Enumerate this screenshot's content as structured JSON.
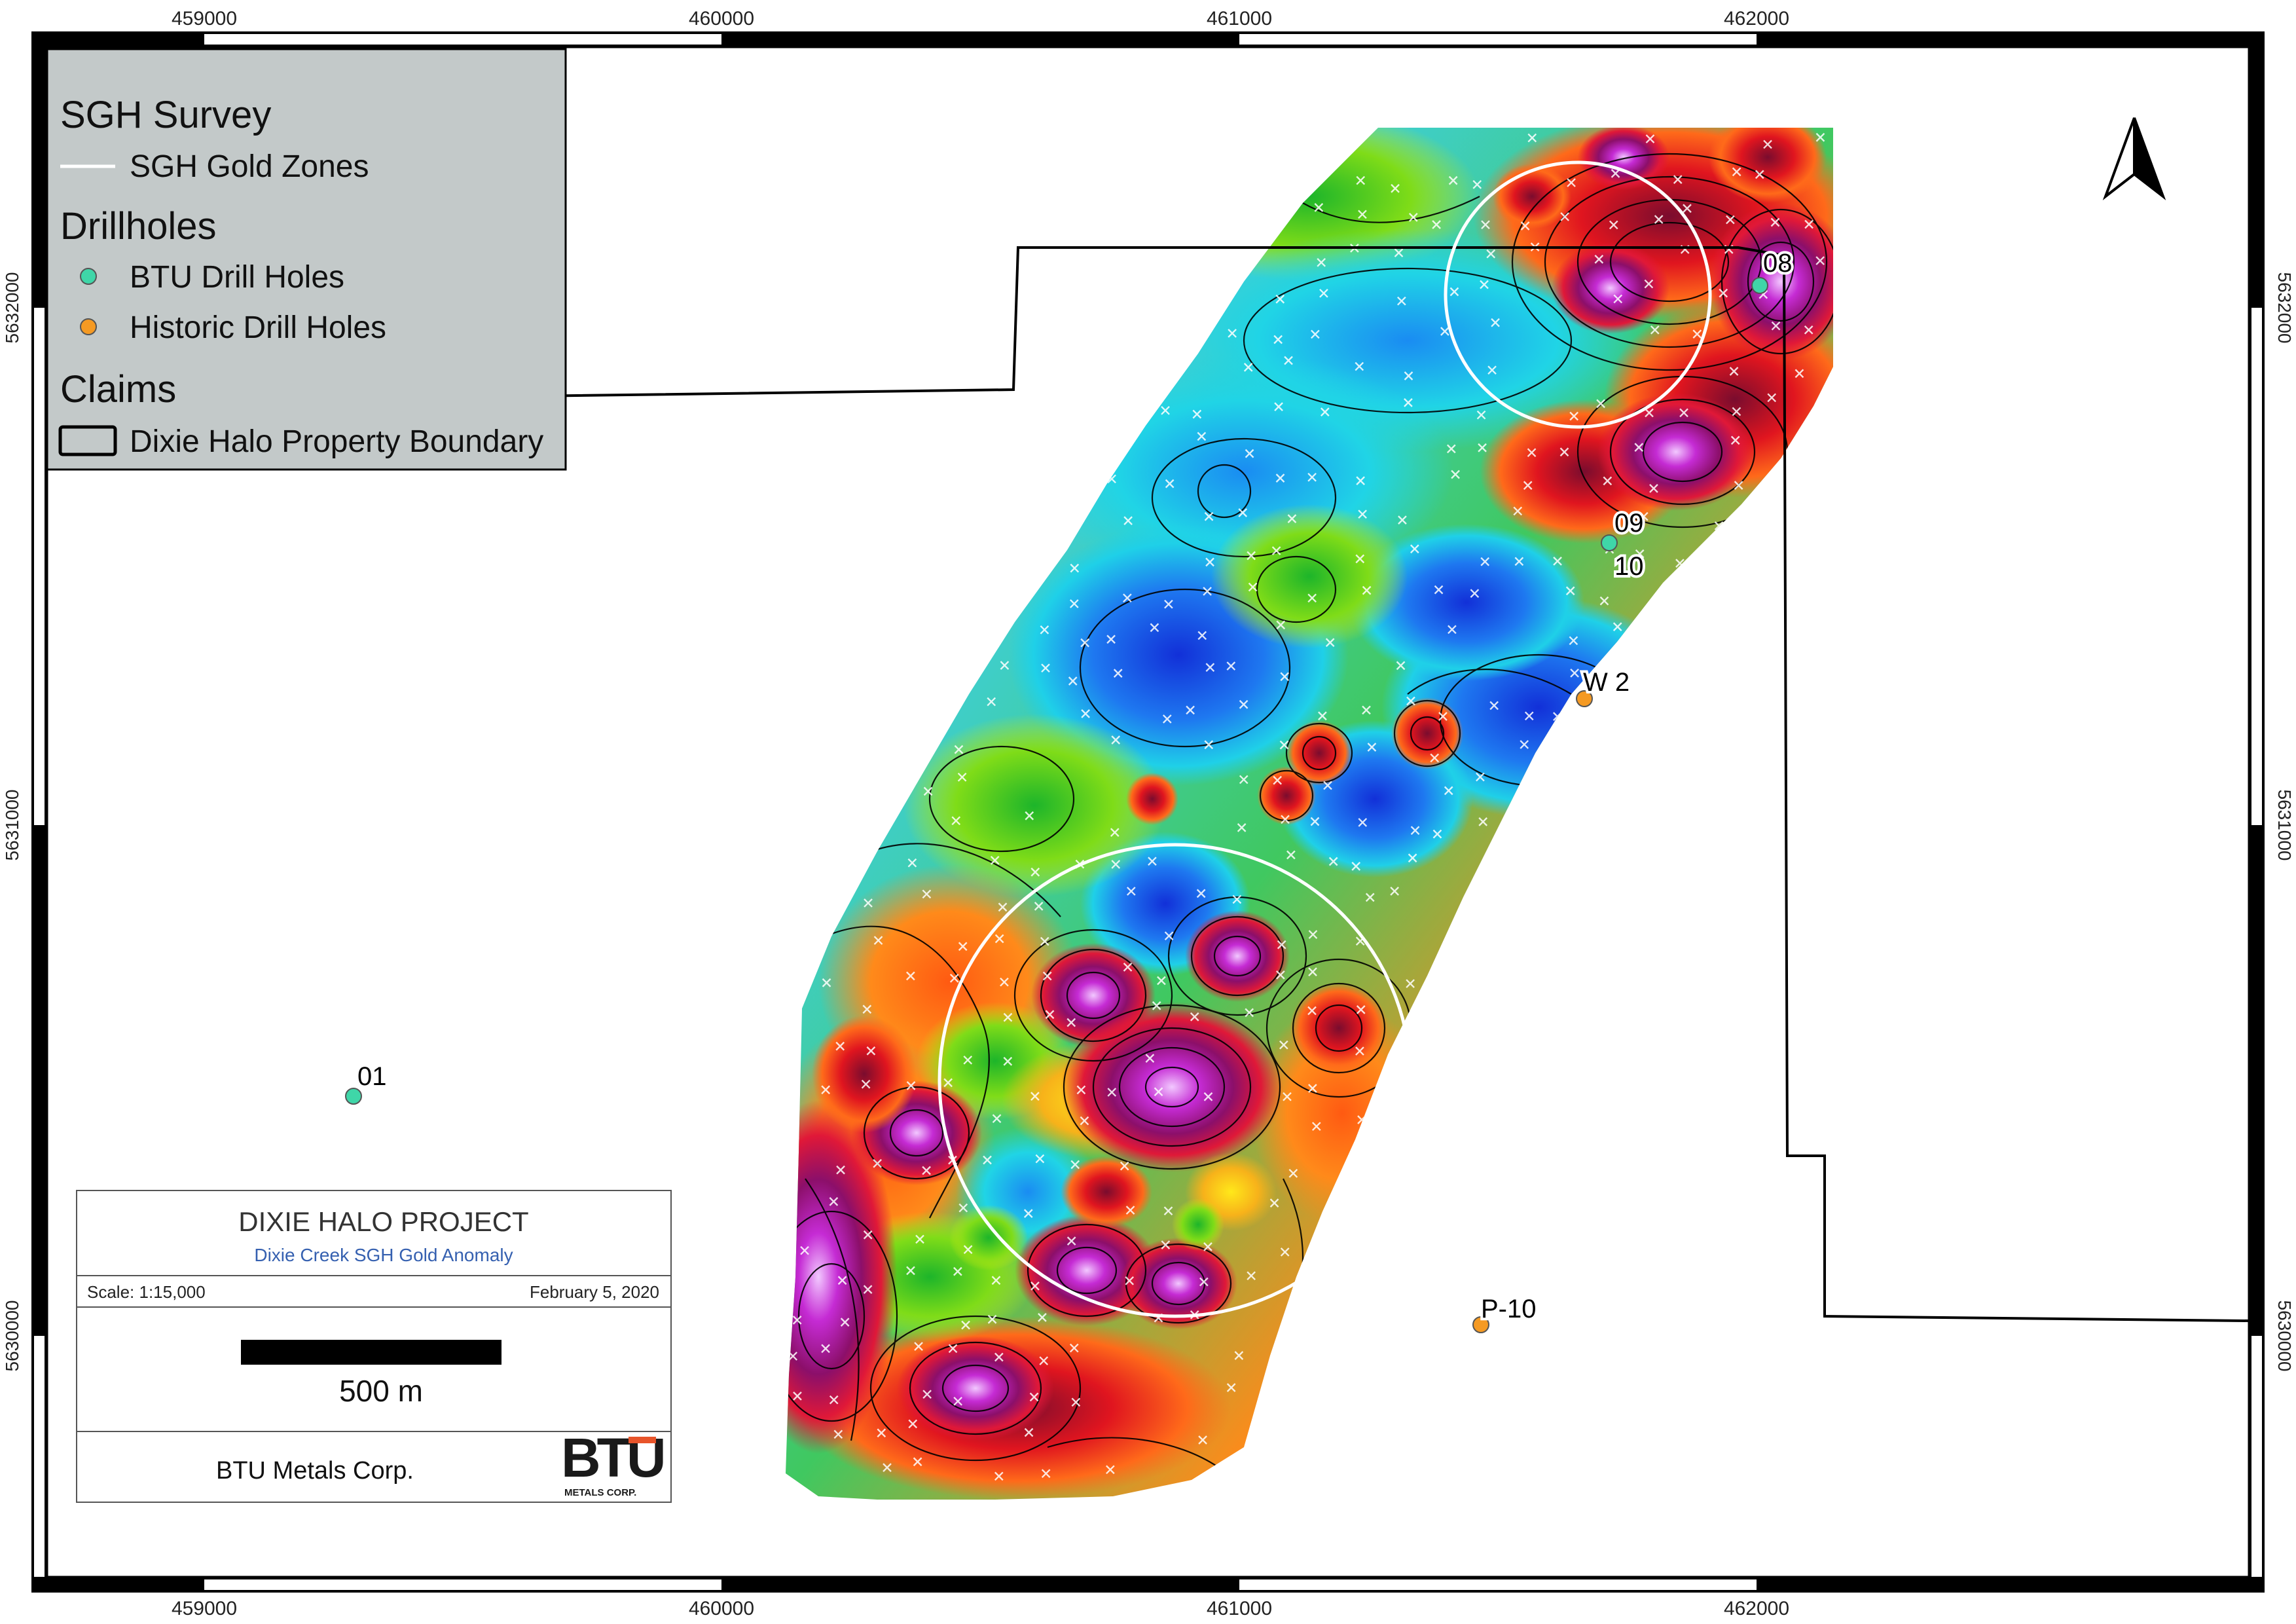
{
  "map": {
    "grid": {
      "x_ticks": [
        "459000",
        "460000",
        "461000",
        "462000"
      ],
      "y_ticks": [
        "5632000",
        "5631000",
        "5630000"
      ]
    },
    "legend": {
      "survey_heading": "SGH Survey",
      "gold_zones_label": "SGH Gold Zones",
      "drillholes_heading": "Drillholes",
      "btu_holes_label": "BTU Drill Holes",
      "historic_holes_label": "Historic Drill Holes",
      "claims_heading": "Claims",
      "boundary_label": "Dixie Halo Property Boundary",
      "colors": {
        "btu_hole": "#3fd6a8",
        "historic_hole": "#f59a23",
        "gold_zone": "#ffffff",
        "boundary": "#000000"
      }
    },
    "drillhole_labels": {
      "h08": "08",
      "h09": "09",
      "h10": "10",
      "w2": "W 2",
      "h01": "01",
      "p10": "P-10"
    },
    "title_block": {
      "project": "DIXIE HALO PROJECT",
      "subtitle": "Dixie Creek SGH Gold Anomaly",
      "scale": "Scale: 1:15,000",
      "date": "February 5, 2020",
      "scalebar_label": "500 m",
      "company": "BTU Metals Corp.",
      "logo_text_main": "BTU",
      "logo_text_sub": "METALS CORP."
    },
    "north_arrow": "north-arrow-icon"
  }
}
